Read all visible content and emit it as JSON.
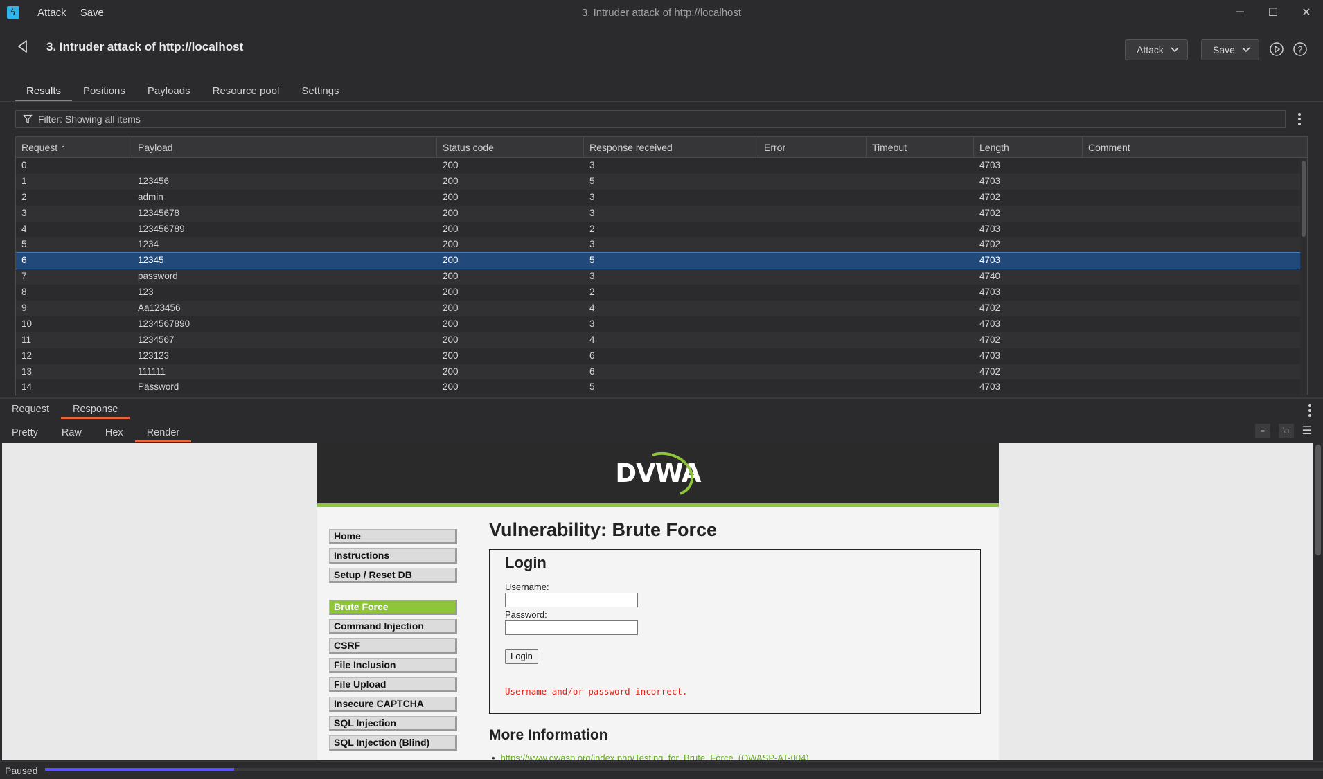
{
  "app": {
    "menu": [
      "Attack",
      "Save"
    ],
    "window_title": "3. Intruder attack of http://localhost",
    "window_controls": [
      "minimize",
      "maximize",
      "close"
    ]
  },
  "header": {
    "title": "3. Intruder attack of http://localhost",
    "attack_button": "Attack",
    "save_button": "Save"
  },
  "tabs": [
    "Results",
    "Positions",
    "Payloads",
    "Resource pool",
    "Settings"
  ],
  "active_tab": "Results",
  "filter": {
    "text": "Filter: Showing all items"
  },
  "table": {
    "columns": [
      "Request",
      "Payload",
      "Status code",
      "Response received",
      "Error",
      "Timeout",
      "Length",
      "Comment"
    ],
    "sort_column": "Request",
    "sort_direction": "ascending",
    "rows": [
      [
        "0",
        "",
        "200",
        "3",
        "",
        "",
        "4703",
        ""
      ],
      [
        "1",
        "123456",
        "200",
        "5",
        "",
        "",
        "4703",
        ""
      ],
      [
        "2",
        "admin",
        "200",
        "3",
        "",
        "",
        "4702",
        ""
      ],
      [
        "3",
        "12345678",
        "200",
        "3",
        "",
        "",
        "4702",
        ""
      ],
      [
        "4",
        "123456789",
        "200",
        "2",
        "",
        "",
        "4703",
        ""
      ],
      [
        "5",
        "1234",
        "200",
        "3",
        "",
        "",
        "4702",
        ""
      ],
      [
        "6",
        "12345",
        "200",
        "5",
        "",
        "",
        "4703",
        ""
      ],
      [
        "7",
        "password",
        "200",
        "3",
        "",
        "",
        "4740",
        ""
      ],
      [
        "8",
        "123",
        "200",
        "2",
        "",
        "",
        "4703",
        ""
      ],
      [
        "9",
        "Aa123456",
        "200",
        "4",
        "",
        "",
        "4702",
        ""
      ],
      [
        "10",
        "1234567890",
        "200",
        "3",
        "",
        "",
        "4703",
        ""
      ],
      [
        "11",
        "1234567",
        "200",
        "4",
        "",
        "",
        "4702",
        ""
      ],
      [
        "12",
        "123123",
        "200",
        "6",
        "",
        "",
        "4703",
        ""
      ],
      [
        "13",
        "111111",
        "200",
        "6",
        "",
        "",
        "4702",
        ""
      ],
      [
        "14",
        "Password",
        "200",
        "5",
        "",
        "",
        "4703",
        ""
      ]
    ],
    "selected_row": 6
  },
  "message_tabs": [
    "Request",
    "Response"
  ],
  "active_message_tab": "Response",
  "view_tabs": [
    "Pretty",
    "Raw",
    "Hex",
    "Render"
  ],
  "active_view_tab": "Render",
  "render": {
    "logo": "DVWA",
    "nav_group1": [
      "Home",
      "Instructions",
      "Setup / Reset DB"
    ],
    "nav_group2": [
      "Brute Force",
      "Command Injection",
      "CSRF",
      "File Inclusion",
      "File Upload",
      "Insecure CAPTCHA",
      "SQL Injection",
      "SQL Injection (Blind)"
    ],
    "active_nav": "Brute Force",
    "page_title": "Vulnerability: Brute Force",
    "login_title": "Login",
    "username_label": "Username:",
    "password_label": "Password:",
    "login_button": "Login",
    "error_message": "Username and/or password incorrect.",
    "more_info_title": "More Information",
    "more_info_link": "https://www.owasp.org/index.php/Testing_for_Brute_Force_(OWASP-AT-004)"
  },
  "status": {
    "text": "Paused",
    "progress_fraction": 0.148
  },
  "colors": {
    "accent_tab": "#e8663a",
    "selected_row": "#21497a",
    "dvwa_green": "#8fc53b",
    "progress": "#5a54ff",
    "error_text": "#e2231a"
  }
}
